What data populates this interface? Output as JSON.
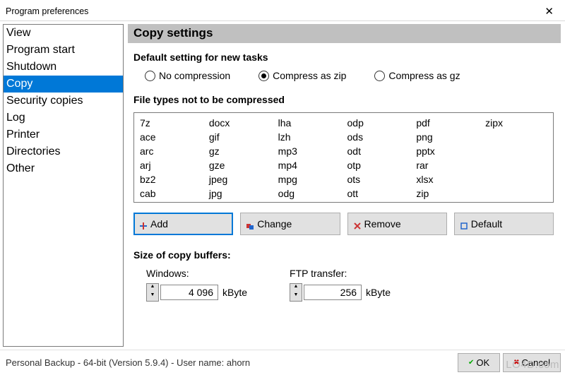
{
  "window": {
    "title": "Program preferences"
  },
  "sidebar": {
    "items": [
      {
        "label": "View"
      },
      {
        "label": "Program start"
      },
      {
        "label": "Shutdown"
      },
      {
        "label": "Copy"
      },
      {
        "label": "Security copies"
      },
      {
        "label": "Log"
      },
      {
        "label": "Printer"
      },
      {
        "label": "Directories"
      },
      {
        "label": "Other"
      }
    ],
    "selected_index": 3
  },
  "content": {
    "header": "Copy settings",
    "default_setting_label": "Default setting for new tasks",
    "compression": {
      "options": [
        {
          "label": "No compression"
        },
        {
          "label": "Compress as zip"
        },
        {
          "label": "Compress as gz"
        }
      ],
      "selected_index": 1
    },
    "filetypes_label": "File types not to be compressed",
    "filetypes": {
      "columns": [
        [
          "7z",
          "ace",
          "arc",
          "arj",
          "bz2",
          "cab"
        ],
        [
          "docx",
          "gif",
          "gz",
          "gze",
          "jpeg",
          "jpg"
        ],
        [
          "lha",
          "lzh",
          "mp3",
          "mp4",
          "mpg",
          "odg"
        ],
        [
          "odp",
          "ods",
          "odt",
          "otp",
          "ots",
          "ott"
        ],
        [
          "pdf",
          "png",
          "pptx",
          "rar",
          "xlsx",
          "zip"
        ],
        [
          "zipx",
          "",
          "",
          "",
          "",
          ""
        ]
      ]
    },
    "buttons": {
      "add": "Add",
      "change": "Change",
      "remove": "Remove",
      "default": "Default"
    },
    "buffers": {
      "title": "Size of copy buffers:",
      "windows_label": "Windows:",
      "windows_value": "4 096",
      "ftp_label": "FTP transfer:",
      "ftp_value": "256",
      "unit": "kByte"
    }
  },
  "footer": {
    "status": "Personal Backup - 64-bit (Version 5.9.4) - User name: ahorn",
    "ok": "OK",
    "cancel": "Cancel"
  },
  "watermark": "LO4D.com"
}
